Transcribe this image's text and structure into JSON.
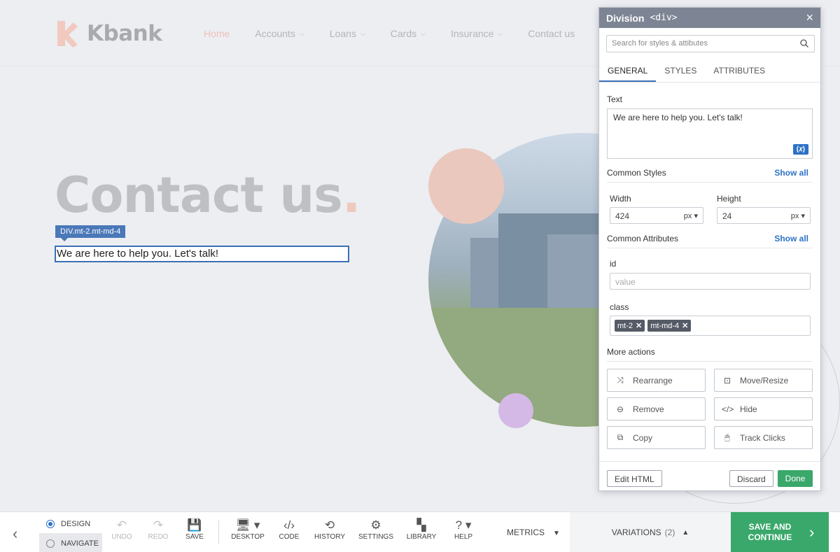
{
  "site": {
    "logo_text": "Kbank",
    "nav": [
      {
        "label": "Home",
        "has_dropdown": false,
        "active": true
      },
      {
        "label": "Accounts",
        "has_dropdown": true
      },
      {
        "label": "Loans",
        "has_dropdown": true
      },
      {
        "label": "Cards",
        "has_dropdown": true
      },
      {
        "label": "Insurance",
        "has_dropdown": true
      },
      {
        "label": "Contact us",
        "has_dropdown": false
      }
    ],
    "hero_title": "Contact us",
    "hero_title_dot": ".",
    "selected_tag": "DIV.mt-2.mt-md-4",
    "selected_text": "We are here to help you. Let's talk!"
  },
  "panel": {
    "title": "Division",
    "element_tag": "<div>",
    "close_icon": "×",
    "search_placeholder": "Search for styles & attibutes",
    "tabs": [
      "GENERAL",
      "STYLES",
      "ATTRIBUTES"
    ],
    "active_tab": "GENERAL",
    "text_label": "Text",
    "text_value": "We are here to help you. Let's talk!",
    "variable_button": "(𝑥)",
    "common_styles_label": "Common Styles",
    "show_all": "Show all",
    "width_label": "Width",
    "width_value": "424",
    "width_unit": "px",
    "height_label": "Height",
    "height_value": "24",
    "height_unit": "px",
    "common_attributes_label": "Common Attributes",
    "id_label": "id",
    "id_placeholder": "value",
    "class_label": "class",
    "classes": [
      "mt-2",
      "mt-md-4"
    ],
    "more_actions_label": "More actions",
    "actions": [
      {
        "label": "Rearrange",
        "icon": "rearrange-icon",
        "glyph": "⤨"
      },
      {
        "label": "Move/Resize",
        "icon": "move-resize-icon",
        "glyph": "⊡"
      },
      {
        "label": "Remove",
        "icon": "remove-icon",
        "glyph": "⊖"
      },
      {
        "label": "Hide",
        "icon": "hide-icon",
        "glyph": "</>"
      },
      {
        "label": "Copy",
        "icon": "copy-icon",
        "glyph": "⧉"
      },
      {
        "label": "Track Clicks",
        "icon": "mouse-icon",
        "glyph": "🖱"
      }
    ],
    "edit_html": "Edit HTML",
    "discard": "Discard",
    "done": "Done"
  },
  "toolbar": {
    "modes": [
      {
        "label": "DESIGN",
        "selected": true
      },
      {
        "label": "NAVIGATE",
        "selected": false
      }
    ],
    "buttons": [
      {
        "label": "UNDO",
        "glyph": "↶",
        "disabled": true
      },
      {
        "label": "REDO",
        "glyph": "↷",
        "disabled": true
      },
      {
        "label": "SAVE",
        "glyph": "💾",
        "disabled": false
      },
      {
        "label": "DESKTOP",
        "glyph": "🖥 ▾",
        "disabled": false
      },
      {
        "label": "CODE",
        "glyph": "‹/›",
        "disabled": false
      },
      {
        "label": "HISTORY",
        "glyph": "⟲",
        "disabled": false
      },
      {
        "label": "SETTINGS",
        "glyph": "⚙",
        "disabled": false
      },
      {
        "label": "LIBRARY",
        "glyph": "▚",
        "disabled": false
      },
      {
        "label": "HELP",
        "glyph": "? ▾",
        "disabled": false
      }
    ],
    "metrics": "METRICS",
    "variations": "VARIATIONS",
    "variations_count": "(2)",
    "save_continue": "SAVE AND CONTINUE"
  },
  "colors": {
    "accent": "#2d72c6",
    "primary_green": "#3aa86b",
    "panel_header": "#7d8594",
    "selection": "#3a6fb5"
  }
}
